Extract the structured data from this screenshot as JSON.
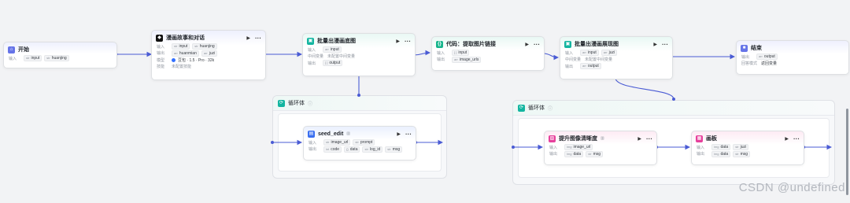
{
  "colors": {
    "edge": "#4a5bd4",
    "start_icon": "#6674e8",
    "llm_icon": "#111111",
    "plugin_icon": "#13b5a0",
    "code_icon": "#17b58c",
    "image_icon": "#e6409c",
    "end_icon": "#6674e8",
    "loop_icon": "#13b5a0"
  },
  "nodes": {
    "start": {
      "title": "开始",
      "icon": "start-icon",
      "rows": [
        {
          "label": "输入",
          "chips": [
            "input",
            "huanjing"
          ]
        }
      ]
    },
    "llm": {
      "title": "漫画故事和对话",
      "icon": "llm-icon",
      "rows": [
        {
          "label": "输入",
          "chips": [
            "input",
            "huanjing"
          ]
        },
        {
          "label": "输出",
          "chips": [
            "huanmian",
            "juzi"
          ]
        },
        {
          "label": "模型",
          "model": "豆包 · 1.5 · Pro · 32k"
        },
        {
          "label": "技能",
          "plain": "未配置技能"
        }
      ]
    },
    "batch1": {
      "title": "批量出漫画底图",
      "icon": "plugin-icon",
      "rows": [
        {
          "label": "输入",
          "chips": [
            "input"
          ]
        },
        {
          "label": "中间变量",
          "plain": "未配置中间变量"
        },
        {
          "label": "输出",
          "chips": [
            "output"
          ]
        }
      ]
    },
    "code": {
      "title": "代码：提取图片链接",
      "icon": "code-icon",
      "rows": [
        {
          "label": "输入",
          "chips": [
            "input"
          ]
        },
        {
          "label": "输出",
          "chips": [
            "image_urls"
          ]
        }
      ]
    },
    "batch2": {
      "title": "批量出漫画展现图",
      "icon": "plugin-icon",
      "rows": [
        {
          "label": "输入",
          "chips": [
            "input",
            "juzi"
          ]
        },
        {
          "label": "中间变量",
          "plain": "未配置中间变量"
        },
        {
          "label": "输出",
          "chips": [
            "output"
          ]
        }
      ]
    },
    "end": {
      "title": "结束",
      "icon": "end-icon",
      "rows": [
        {
          "label": "输出",
          "chips": [
            "output"
          ]
        },
        {
          "label": "回答模式",
          "plain": "返回变量"
        }
      ]
    },
    "seed": {
      "title": "seed_edit",
      "icon": "image-tool-icon",
      "rows": [
        {
          "label": "输入",
          "chips": [
            "image_url",
            "prompt"
          ]
        },
        {
          "label": "输出",
          "chips": [
            "code",
            "data",
            "log_id",
            "msg"
          ]
        }
      ]
    },
    "enhance": {
      "title": "提升图像清晰度",
      "icon": "image-tool-icon",
      "rows": [
        {
          "label": "输入",
          "chips": [
            "image_url"
          ]
        },
        {
          "label": "输出",
          "chips": [
            "data",
            "msg"
          ]
        }
      ]
    },
    "board": {
      "title": "画板",
      "icon": "board-icon",
      "rows": [
        {
          "label": "输入",
          "chips": [
            "data",
            "juzi"
          ]
        },
        {
          "label": "输出",
          "chips": [
            "data",
            "msg"
          ]
        }
      ]
    }
  },
  "loops": {
    "loop1": {
      "title": "循环体"
    },
    "loop2": {
      "title": "循环体"
    }
  },
  "tools": {
    "run": "▶",
    "more": "···"
  },
  "watermark": "CSDN @undefined"
}
